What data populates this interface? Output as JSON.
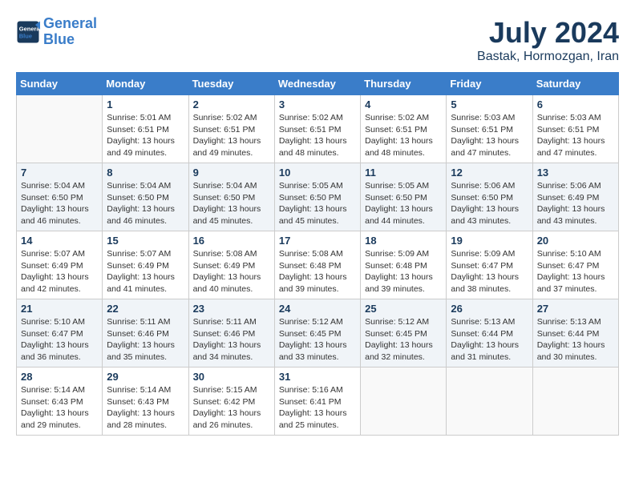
{
  "header": {
    "logo_line1": "General",
    "logo_line2": "Blue",
    "month_year": "July 2024",
    "location": "Bastak, Hormozgan, Iran"
  },
  "weekdays": [
    "Sunday",
    "Monday",
    "Tuesday",
    "Wednesday",
    "Thursday",
    "Friday",
    "Saturday"
  ],
  "weeks": [
    [
      {
        "day": "",
        "detail": ""
      },
      {
        "day": "1",
        "detail": "Sunrise: 5:01 AM\nSunset: 6:51 PM\nDaylight: 13 hours\nand 49 minutes."
      },
      {
        "day": "2",
        "detail": "Sunrise: 5:02 AM\nSunset: 6:51 PM\nDaylight: 13 hours\nand 49 minutes."
      },
      {
        "day": "3",
        "detail": "Sunrise: 5:02 AM\nSunset: 6:51 PM\nDaylight: 13 hours\nand 48 minutes."
      },
      {
        "day": "4",
        "detail": "Sunrise: 5:02 AM\nSunset: 6:51 PM\nDaylight: 13 hours\nand 48 minutes."
      },
      {
        "day": "5",
        "detail": "Sunrise: 5:03 AM\nSunset: 6:51 PM\nDaylight: 13 hours\nand 47 minutes."
      },
      {
        "day": "6",
        "detail": "Sunrise: 5:03 AM\nSunset: 6:51 PM\nDaylight: 13 hours\nand 47 minutes."
      }
    ],
    [
      {
        "day": "7",
        "detail": "Sunrise: 5:04 AM\nSunset: 6:50 PM\nDaylight: 13 hours\nand 46 minutes."
      },
      {
        "day": "8",
        "detail": "Sunrise: 5:04 AM\nSunset: 6:50 PM\nDaylight: 13 hours\nand 46 minutes."
      },
      {
        "day": "9",
        "detail": "Sunrise: 5:04 AM\nSunset: 6:50 PM\nDaylight: 13 hours\nand 45 minutes."
      },
      {
        "day": "10",
        "detail": "Sunrise: 5:05 AM\nSunset: 6:50 PM\nDaylight: 13 hours\nand 45 minutes."
      },
      {
        "day": "11",
        "detail": "Sunrise: 5:05 AM\nSunset: 6:50 PM\nDaylight: 13 hours\nand 44 minutes."
      },
      {
        "day": "12",
        "detail": "Sunrise: 5:06 AM\nSunset: 6:50 PM\nDaylight: 13 hours\nand 43 minutes."
      },
      {
        "day": "13",
        "detail": "Sunrise: 5:06 AM\nSunset: 6:49 PM\nDaylight: 13 hours\nand 43 minutes."
      }
    ],
    [
      {
        "day": "14",
        "detail": "Sunrise: 5:07 AM\nSunset: 6:49 PM\nDaylight: 13 hours\nand 42 minutes."
      },
      {
        "day": "15",
        "detail": "Sunrise: 5:07 AM\nSunset: 6:49 PM\nDaylight: 13 hours\nand 41 minutes."
      },
      {
        "day": "16",
        "detail": "Sunrise: 5:08 AM\nSunset: 6:49 PM\nDaylight: 13 hours\nand 40 minutes."
      },
      {
        "day": "17",
        "detail": "Sunrise: 5:08 AM\nSunset: 6:48 PM\nDaylight: 13 hours\nand 39 minutes."
      },
      {
        "day": "18",
        "detail": "Sunrise: 5:09 AM\nSunset: 6:48 PM\nDaylight: 13 hours\nand 39 minutes."
      },
      {
        "day": "19",
        "detail": "Sunrise: 5:09 AM\nSunset: 6:47 PM\nDaylight: 13 hours\nand 38 minutes."
      },
      {
        "day": "20",
        "detail": "Sunrise: 5:10 AM\nSunset: 6:47 PM\nDaylight: 13 hours\nand 37 minutes."
      }
    ],
    [
      {
        "day": "21",
        "detail": "Sunrise: 5:10 AM\nSunset: 6:47 PM\nDaylight: 13 hours\nand 36 minutes."
      },
      {
        "day": "22",
        "detail": "Sunrise: 5:11 AM\nSunset: 6:46 PM\nDaylight: 13 hours\nand 35 minutes."
      },
      {
        "day": "23",
        "detail": "Sunrise: 5:11 AM\nSunset: 6:46 PM\nDaylight: 13 hours\nand 34 minutes."
      },
      {
        "day": "24",
        "detail": "Sunrise: 5:12 AM\nSunset: 6:45 PM\nDaylight: 13 hours\nand 33 minutes."
      },
      {
        "day": "25",
        "detail": "Sunrise: 5:12 AM\nSunset: 6:45 PM\nDaylight: 13 hours\nand 32 minutes."
      },
      {
        "day": "26",
        "detail": "Sunrise: 5:13 AM\nSunset: 6:44 PM\nDaylight: 13 hours\nand 31 minutes."
      },
      {
        "day": "27",
        "detail": "Sunrise: 5:13 AM\nSunset: 6:44 PM\nDaylight: 13 hours\nand 30 minutes."
      }
    ],
    [
      {
        "day": "28",
        "detail": "Sunrise: 5:14 AM\nSunset: 6:43 PM\nDaylight: 13 hours\nand 29 minutes."
      },
      {
        "day": "29",
        "detail": "Sunrise: 5:14 AM\nSunset: 6:43 PM\nDaylight: 13 hours\nand 28 minutes."
      },
      {
        "day": "30",
        "detail": "Sunrise: 5:15 AM\nSunset: 6:42 PM\nDaylight: 13 hours\nand 26 minutes."
      },
      {
        "day": "31",
        "detail": "Sunrise: 5:16 AM\nSunset: 6:41 PM\nDaylight: 13 hours\nand 25 minutes."
      },
      {
        "day": "",
        "detail": ""
      },
      {
        "day": "",
        "detail": ""
      },
      {
        "day": "",
        "detail": ""
      }
    ]
  ]
}
